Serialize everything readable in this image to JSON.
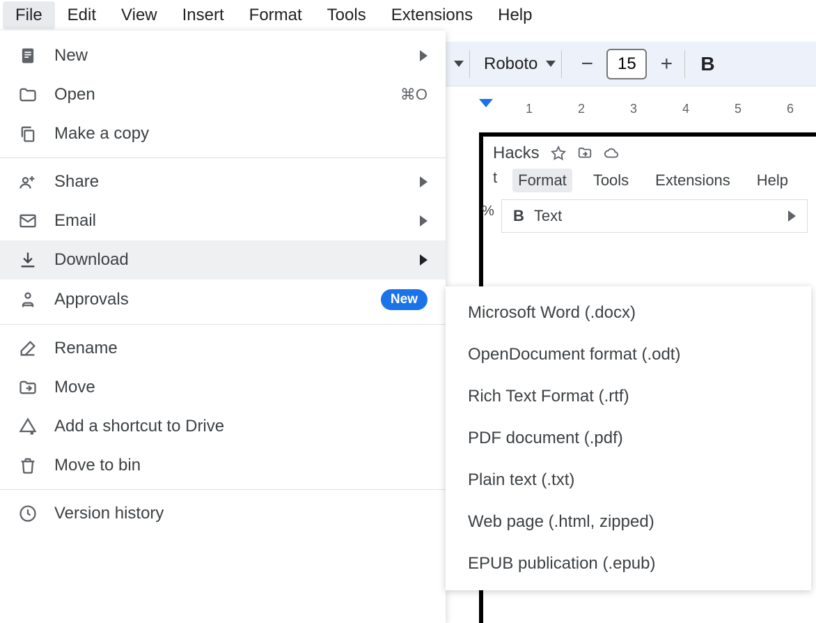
{
  "menubar": [
    "File",
    "Edit",
    "View",
    "Insert",
    "Format",
    "Tools",
    "Extensions",
    "Help"
  ],
  "toolbar": {
    "font": "Roboto",
    "fontSize": "15",
    "bold": "B"
  },
  "ruler": [
    "1",
    "2",
    "3",
    "4",
    "5",
    "6"
  ],
  "embedded": {
    "title": "Hacks",
    "menubar_t": "t",
    "menubar": [
      "Format",
      "Tools",
      "Extensions",
      "Help"
    ],
    "pct": "%",
    "submenu_bold": "B",
    "submenu_text": "Text"
  },
  "fileMenu": {
    "new": "New",
    "open": "Open",
    "open_shortcut": "⌘O",
    "copy": "Make a copy",
    "share": "Share",
    "email": "Email",
    "download": "Download",
    "approvals": "Approvals",
    "approvals_badge": "New",
    "rename": "Rename",
    "move": "Move",
    "shortcut": "Add a shortcut to Drive",
    "bin": "Move to bin",
    "version": "Version history"
  },
  "downloadMenu": [
    "Microsoft Word (.docx)",
    "OpenDocument format (.odt)",
    "Rich Text Format (.rtf)",
    "PDF document (.pdf)",
    "Plain text (.txt)",
    "Web page (.html, zipped)",
    "EPUB publication (.epub)"
  ]
}
